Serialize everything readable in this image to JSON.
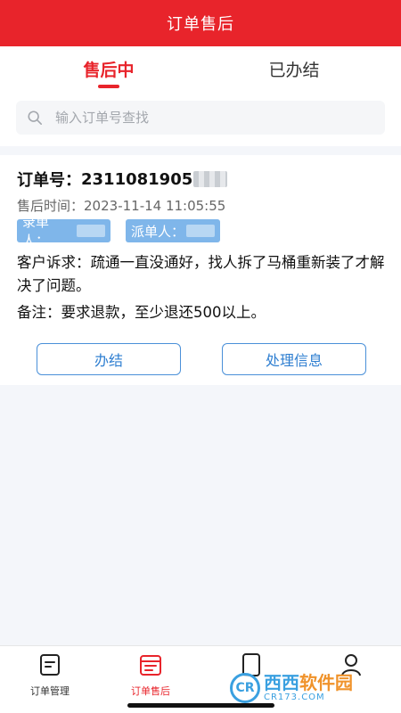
{
  "header": {
    "title": "订单售后"
  },
  "tabs": [
    {
      "label": "售后中",
      "active": true
    },
    {
      "label": "已办结",
      "active": false
    }
  ],
  "search": {
    "placeholder": "输入订单号查找",
    "value": ""
  },
  "order": {
    "number_label": "订单号：",
    "number": "2311081905",
    "time_label": "售后时间：",
    "time": "2023-11-14 11:05:55",
    "recorder_label": "录单人：",
    "dispatcher_label": "派单人：",
    "complaint": "客户诉求：疏通一直没通好，找人拆了马桶重新装了才解决了问题。",
    "remark": "备注：要求退款，至少退还500以上。",
    "actions": {
      "finish": "办结",
      "process": "处理信息"
    }
  },
  "bottom_nav": [
    {
      "label": "订单管理",
      "icon": "order-manage-icon",
      "active": false
    },
    {
      "label": "订单售后",
      "icon": "order-aftersale-icon",
      "active": true
    },
    {
      "label": "",
      "icon": "phone-icon",
      "active": false
    },
    {
      "label": "",
      "icon": "profile-icon",
      "active": false
    }
  ],
  "watermark": {
    "main_a": "西西",
    "main_b": "软件园",
    "sub": "CR173.COM",
    "logo": "CR"
  },
  "colors": {
    "brand_red": "#e8242b",
    "accent_blue": "#4a90d9",
    "tag_blue": "#7fb6ea"
  }
}
